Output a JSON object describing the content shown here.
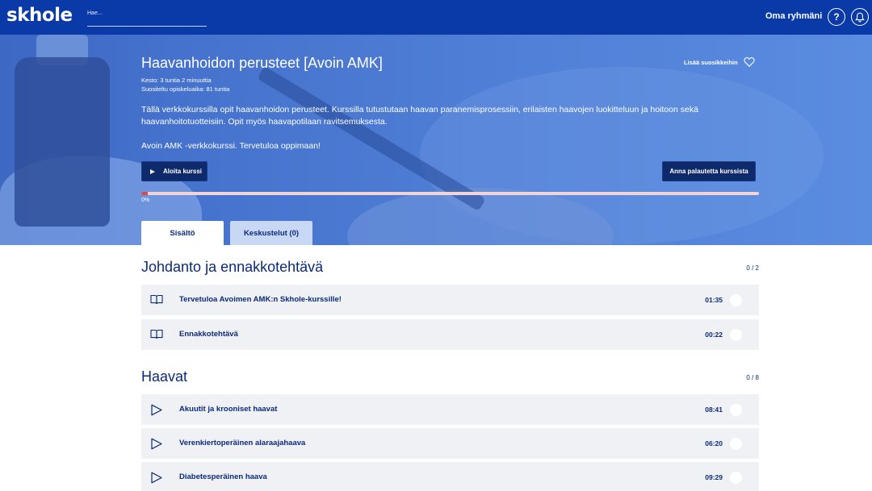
{
  "header": {
    "logo": "skhole",
    "search_placeholder": "Hae...",
    "group_link": "Oma ryhmäni",
    "help_label": "?"
  },
  "course": {
    "title": "Haavanhoidon perusteet [Avoin AMK]",
    "duration": "Kesto: 3 tuntia 2 minuuttia",
    "study_time": "Suositeltu opiskeluaika: 81 tuntia",
    "favorite_label": "Lisää suosikkeihin",
    "description_1": "Tällä verkkokurssilla opit haavanhoidon perusteet. Kurssilla tutustutaan haavan paranemisprosessiin, erilaisten haavojen luokitteluun ja hoitoon sekä haavanhoitotuotteisiin. Opit myös haavapotilaan ravitsemuksesta.",
    "description_2": "Avoin AMK -verkkokurssi. Tervetuloa oppimaan!",
    "start_label": "Aloita kurssi",
    "feedback_label": "Anna palautetta kurssista",
    "progress_label": "0%",
    "progress_value": 0.01
  },
  "tabs": [
    {
      "label": "Sisältö",
      "active": true
    },
    {
      "label": "Keskustelut (0)",
      "active": false
    }
  ],
  "sections": [
    {
      "title": "Johdanto ja ennakkotehtävä",
      "count": "0 / 2",
      "items": [
        {
          "icon": "book-icon",
          "label": "Tervetuloa Avoimen AMK:n Skhole-kurssille!",
          "time": "01:35"
        },
        {
          "icon": "book-icon",
          "label": "Ennakkotehtävä",
          "time": "00:22"
        }
      ]
    },
    {
      "title": "Haavat",
      "count": "0 / 8",
      "items": [
        {
          "icon": "play-icon",
          "label": "Akuutit ja krooniset haavat",
          "time": "08:41"
        },
        {
          "icon": "play-icon",
          "label": "Verenkiertoperäinen alaraajahaava",
          "time": "06:20"
        },
        {
          "icon": "play-icon",
          "label": "Diabetesperäinen haava",
          "time": "09:29"
        }
      ]
    }
  ],
  "colors": {
    "nav": "#0a3aa8",
    "text": "#0a2a7a",
    "progress_track": "#f2d4d6",
    "row_bg": "#eff1f5"
  }
}
